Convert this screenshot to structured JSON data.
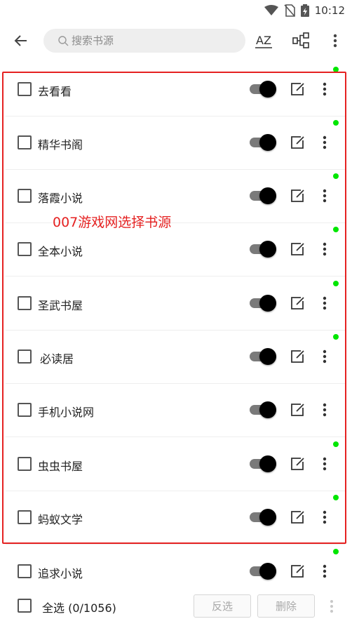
{
  "status_bar": {
    "time": "10:12"
  },
  "top_bar": {
    "search_placeholder": "搜索书源",
    "sort_label": "AZ"
  },
  "sources": [
    {
      "name": "去看看",
      "enabled": true,
      "status_dot": "green"
    },
    {
      "name": "精华书阁",
      "enabled": true,
      "status_dot": "green"
    },
    {
      "name": "落霞小说",
      "enabled": true,
      "status_dot": "green"
    },
    {
      "name": "全本小说",
      "enabled": true,
      "status_dot": "green"
    },
    {
      "name": "圣武书屋",
      "enabled": true,
      "status_dot": "green"
    },
    {
      "name": "必读居",
      "enabled": true,
      "status_dot": "green"
    },
    {
      "name": "手机小说网",
      "enabled": true,
      "status_dot": "none"
    },
    {
      "name": "虫虫书屋",
      "enabled": true,
      "status_dot": "green"
    },
    {
      "name": "蚂蚁文学",
      "enabled": true,
      "status_dot": "green"
    },
    {
      "name": "追求小说",
      "enabled": true,
      "status_dot": "green"
    }
  ],
  "watermark": "007游戏网选择书源",
  "footer": {
    "select_all_label": "全选 (0/1056)",
    "invert_label": "反选",
    "delete_label": "删除"
  },
  "colors": {
    "accent_red": "#e52121",
    "status_green": "#00e600",
    "toggle_knob": "#000000",
    "toggle_track": "#7a7a7a"
  }
}
